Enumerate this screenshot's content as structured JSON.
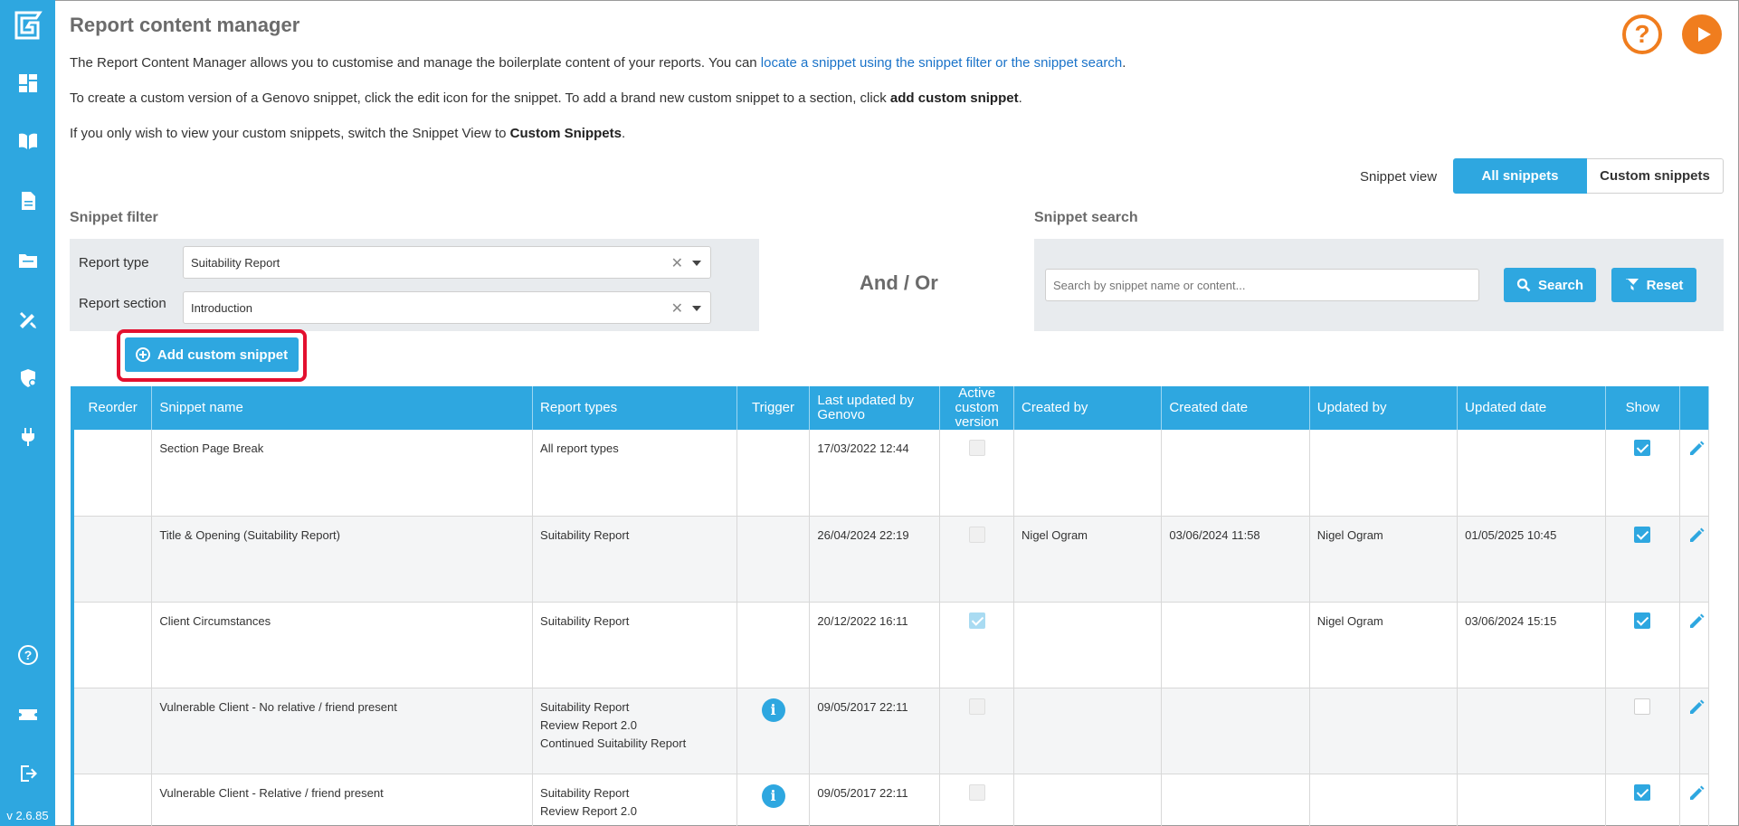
{
  "app": {
    "version": "v 2.6.85",
    "sidebar_icons": [
      "dashboard-icon",
      "library-icon",
      "document-icon",
      "folder-icon",
      "tools-icon",
      "shield-settings-icon",
      "plug-icon",
      "help-icon",
      "ticket-icon",
      "logout-icon"
    ]
  },
  "header": {
    "title": "Report content manager"
  },
  "intro": {
    "line1_pre": "The Report Content Manager allows you to customise and manage the boilerplate content of your reports. You can ",
    "line1_link": "locate a snippet using the snippet filter or the snippet search",
    "line1_post": ".",
    "line2_pre": "To create a custom version of a Genovo snippet, click the edit icon for the snippet. To add a brand new custom snippet to a section, click ",
    "line2_bold": "add custom snippet",
    "line2_post": ".",
    "line3_pre": "If you only wish to view your custom snippets, switch the Snippet View to ",
    "line3_bold": "Custom Snippets",
    "line3_post": "."
  },
  "snippet_view": {
    "label": "Snippet view",
    "options": [
      "All snippets",
      "Custom snippets"
    ],
    "selected": "All snippets"
  },
  "filter": {
    "title": "Snippet filter",
    "report_type_label": "Report type",
    "report_type_value": "Suitability Report",
    "report_section_label": "Report section",
    "report_section_value": "Introduction"
  },
  "and_or": "And / Or",
  "search": {
    "title": "Snippet search",
    "placeholder": "Search by snippet name or content...",
    "search_label": "Search",
    "reset_label": "Reset"
  },
  "add_button": "Add custom snippet",
  "table": {
    "headers": {
      "reorder": "Reorder",
      "name": "Snippet name",
      "report_types": "Report types",
      "trigger": "Trigger",
      "last_updated": "Last updated by Genovo",
      "active_custom": "Active custom version",
      "created_by": "Created by",
      "created_date": "Created date",
      "updated_by": "Updated by",
      "updated_date": "Updated date",
      "show": "Show"
    },
    "rows": [
      {
        "name": "Section Page Break",
        "report_types": "All report types",
        "trigger": false,
        "last_updated": "17/03/2022 12:44",
        "active_custom": false,
        "created_by": "",
        "created_date": "",
        "updated_by": "",
        "updated_date": "",
        "show": true
      },
      {
        "name": "Title & Opening (Suitability Report)",
        "report_types": "Suitability Report",
        "trigger": false,
        "last_updated": "26/04/2024 22:19",
        "active_custom": false,
        "created_by": "Nigel Ogram",
        "created_date": "03/06/2024 11:58",
        "updated_by": "Nigel Ogram",
        "updated_date": "01/05/2025 10:45",
        "show": true
      },
      {
        "name": "Client Circumstances",
        "report_types": "Suitability Report",
        "trigger": false,
        "last_updated": "20/12/2022 16:11",
        "active_custom": true,
        "created_by": "",
        "created_date": "",
        "updated_by": "Nigel Ogram",
        "updated_date": "03/06/2024 15:15",
        "show": true
      },
      {
        "name": "Vulnerable Client - No relative / friend present",
        "report_types": "Suitability Report\nReview Report 2.0\nContinued Suitability Report",
        "trigger": true,
        "last_updated": "09/05/2017 22:11",
        "active_custom": false,
        "created_by": "",
        "created_date": "",
        "updated_by": "",
        "updated_date": "",
        "show": false
      },
      {
        "name": "Vulnerable Client - Relative / friend present",
        "report_types": "Suitability Report\nReview Report 2.0",
        "trigger": true,
        "last_updated": "09/05/2017 22:11",
        "active_custom": false,
        "created_by": "",
        "created_date": "",
        "updated_by": "",
        "updated_date": "",
        "show": true
      }
    ]
  },
  "colors": {
    "primary": "#2ea7e0",
    "accent": "#f07d1e",
    "highlight": "#e3102f"
  }
}
